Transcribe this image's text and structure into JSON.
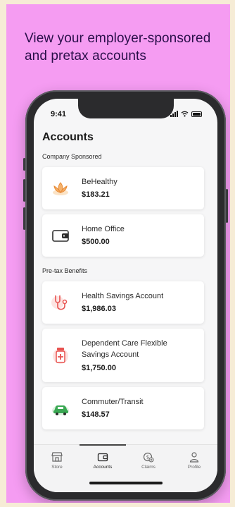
{
  "headline": "View your employer-sponsored and pretax accounts",
  "status": {
    "time": "9:41"
  },
  "page_title": "Accounts",
  "sections": {
    "company": "Company Sponsored",
    "pretax": "Pre-tax Benefits"
  },
  "accounts": [
    {
      "name": "BeHealthy",
      "amount": "$183.21",
      "icon": "lotus-icon"
    },
    {
      "name": "Home Office",
      "amount": "$500.00",
      "icon": "wallet-icon"
    },
    {
      "name": "Health Savings Account",
      "amount": "$1,986.03",
      "icon": "stethoscope-icon"
    },
    {
      "name": "Dependent Care Flexible Savings Account",
      "amount": "$1,750.00",
      "icon": "medicine-bottle-icon"
    },
    {
      "name": "Commuter/Transit",
      "amount": "$148.57",
      "icon": "car-icon"
    }
  ],
  "tabs": [
    {
      "label": "Store",
      "icon": "store-icon"
    },
    {
      "label": "Accounts",
      "icon": "wallet-icon",
      "active": true
    },
    {
      "label": "Claims",
      "icon": "claims-icon"
    },
    {
      "label": "Profile",
      "icon": "person-icon"
    }
  ],
  "colors": {
    "promo_background": "#f59cf2",
    "headline": "#2a0f4a",
    "accent_orange": "#f08a3c",
    "accent_red": "#e8524f",
    "accent_green": "#3aa853"
  }
}
